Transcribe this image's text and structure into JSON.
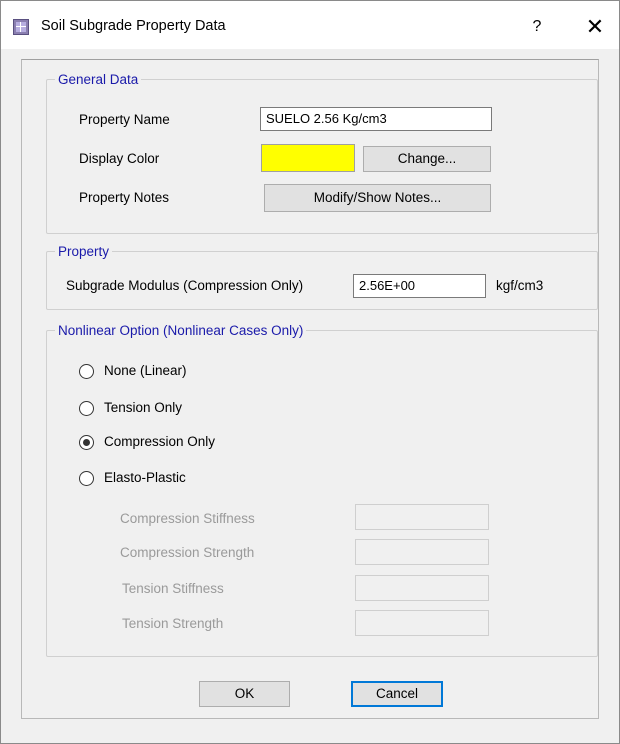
{
  "window": {
    "title": "Soil Subgrade Property Data",
    "help_label": "?",
    "close_label": "✕"
  },
  "general_data": {
    "legend": "General Data",
    "property_name_label": "Property Name",
    "property_name_value": "SUELO 2.56 Kg/cm3",
    "display_color_label": "Display Color",
    "display_color": "#ffff00",
    "change_button": "Change...",
    "property_notes_label": "Property Notes",
    "notes_button": "Modify/Show Notes..."
  },
  "property": {
    "legend": "Property",
    "subgrade_label": "Subgrade Modulus  (Compression Only)",
    "subgrade_value": "2.56E+00",
    "subgrade_unit": "kgf/cm3"
  },
  "nonlinear": {
    "legend": "Nonlinear Option  (Nonlinear Cases Only)",
    "options": [
      {
        "label": "None (Linear)",
        "selected": false
      },
      {
        "label": "Tension Only",
        "selected": false
      },
      {
        "label": "Compression Only",
        "selected": true
      },
      {
        "label": "Elasto-Plastic",
        "selected": false
      }
    ],
    "fields": [
      {
        "label": "Compression Stiffness",
        "value": ""
      },
      {
        "label": "Compression Strength",
        "value": ""
      },
      {
        "label": "Tension Stiffness",
        "value": ""
      },
      {
        "label": "Tension Strength",
        "value": ""
      }
    ]
  },
  "buttons": {
    "ok": "OK",
    "cancel": "Cancel"
  }
}
